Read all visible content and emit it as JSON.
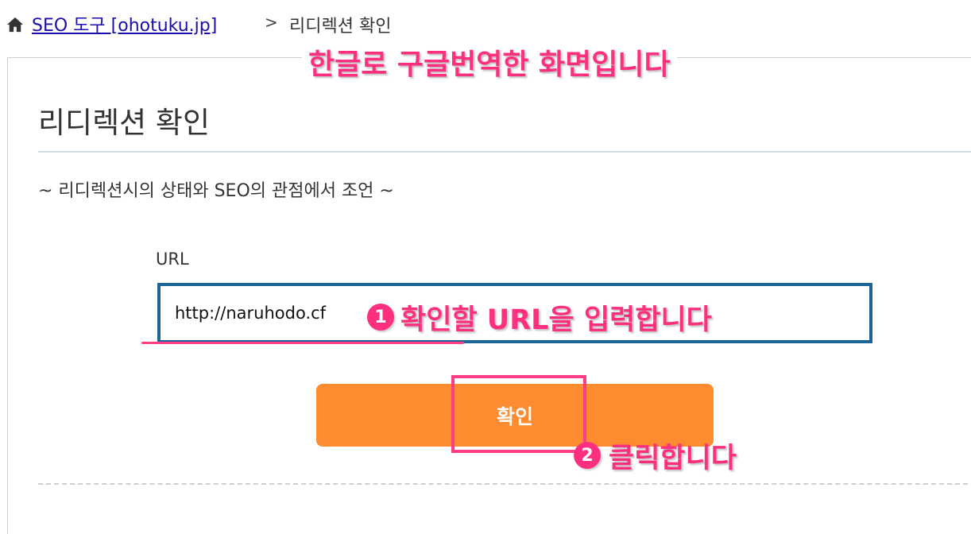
{
  "breadcrumb": {
    "icon": "home-icon",
    "link_label": "SEO 도구 [ohotuku.jp]",
    "separator": ">",
    "current": "리디렉션 확인"
  },
  "annotations": {
    "title": "한글로 구글번역한 화면입니다",
    "step1_badge": "1",
    "step1_text": "확인할 URL을 입력합니다",
    "step2_badge": "2",
    "step2_text": "클릭합니다",
    "color": "#ff2f80"
  },
  "page": {
    "title": "리디렉션 확인",
    "subtitle": "~ 리디렉션시의 상태와 SEO의 관점에서 조언 ~"
  },
  "form": {
    "url_label": "URL",
    "url_value": "http://naruhodo.cf",
    "submit_label": "확인",
    "input_border_color": "#1b6597",
    "button_color": "#fd8b30"
  }
}
